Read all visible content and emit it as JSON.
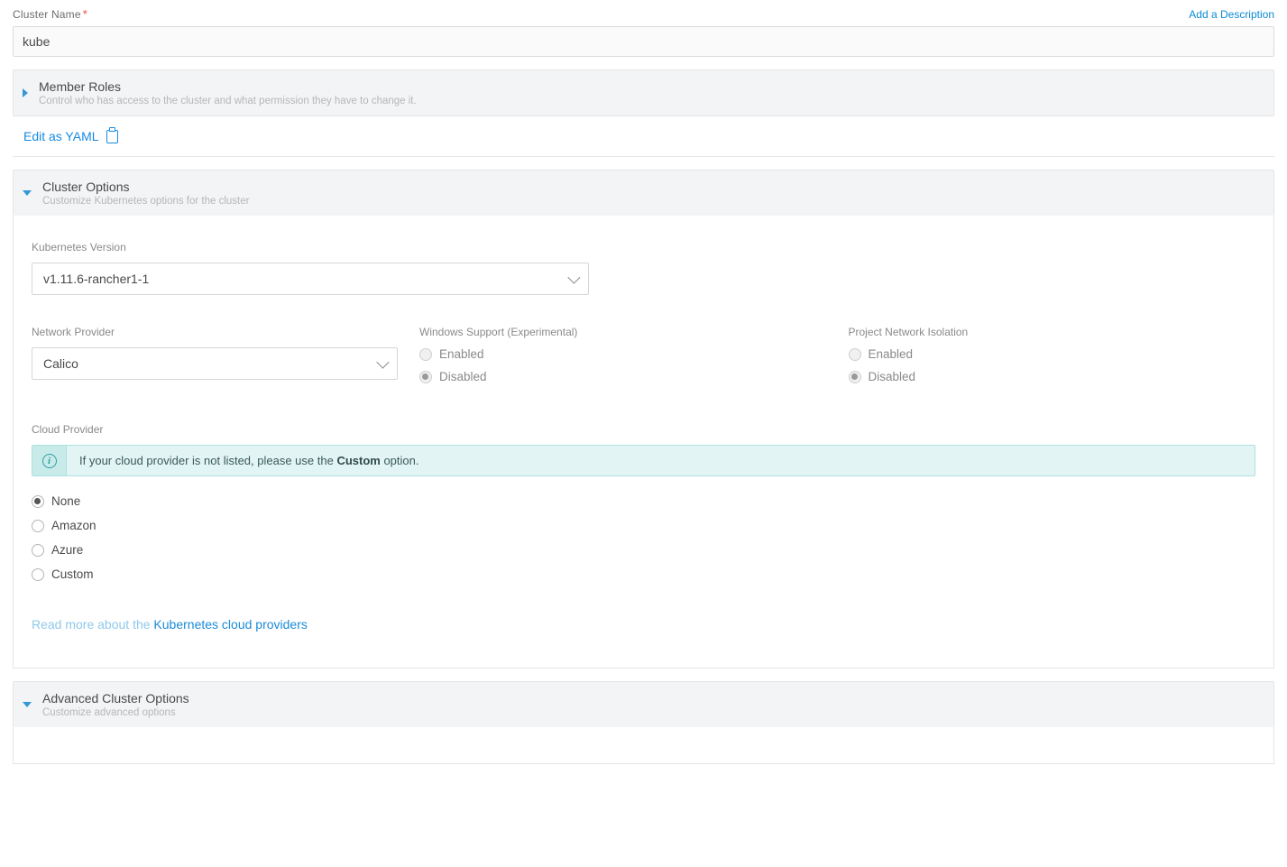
{
  "cluster_name": {
    "label": "Cluster Name",
    "value": "kube"
  },
  "add_description": "Add a Description",
  "member_roles": {
    "title": "Member Roles",
    "subtitle": "Control who has access to the cluster and what permission they have to change it."
  },
  "edit_as_yaml": "Edit as YAML",
  "cluster_options": {
    "title": "Cluster Options",
    "subtitle": "Customize Kubernetes options for the cluster"
  },
  "k8s_version": {
    "label": "Kubernetes Version",
    "value": "v1.11.6-rancher1-1"
  },
  "network_provider": {
    "label": "Network Provider",
    "value": "Calico"
  },
  "windows_support": {
    "label": "Windows Support (Experimental)",
    "enabled": "Enabled",
    "disabled": "Disabled"
  },
  "project_isolation": {
    "label": "Project Network Isolation",
    "enabled": "Enabled",
    "disabled": "Disabled"
  },
  "cloud_provider": {
    "label": "Cloud Provider",
    "info_prefix": "If your cloud provider is not listed, please use the ",
    "info_bold": "Custom",
    "info_suffix": " option.",
    "options": {
      "none": "None",
      "amazon": "Amazon",
      "azure": "Azure",
      "custom": "Custom"
    },
    "read_more_prefix": "Read more about the ",
    "read_more_link": "Kubernetes cloud providers"
  },
  "advanced": {
    "title": "Advanced Cluster Options",
    "subtitle": "Customize advanced options"
  }
}
